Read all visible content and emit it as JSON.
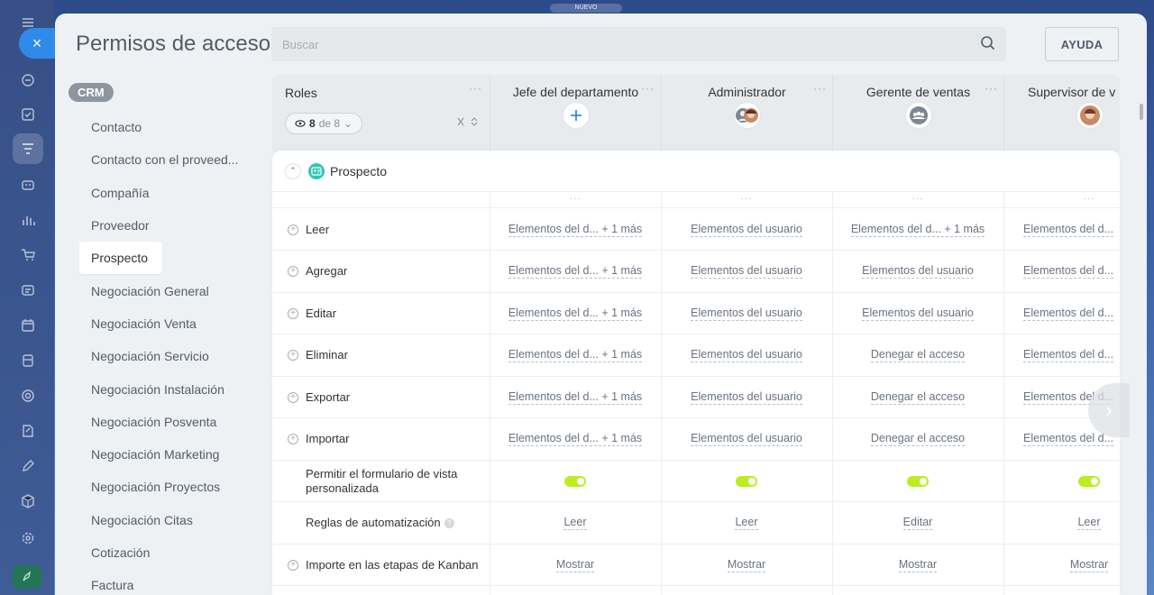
{
  "top_badge": "NUEVO",
  "close_label": "×",
  "rail_icons": [
    "menu-icon",
    "bell-icon",
    "check-square-icon",
    "filter-icon",
    "robot-icon",
    "chart-bars-icon",
    "cart-icon",
    "inbox-icon",
    "calendar-icon",
    "building-icon",
    "target-icon",
    "doc-edit-icon",
    "pen-icon",
    "box-icon",
    "gear-icon",
    "rocket-icon"
  ],
  "header": {
    "title": "Permisos de acceso",
    "search_placeholder": "Buscar",
    "help_label": "AYUDA"
  },
  "menu": {
    "badge": "CRM",
    "items": [
      {
        "label": "Contacto"
      },
      {
        "label": "Contacto con el proveed..."
      },
      {
        "label": "Compañía"
      },
      {
        "label": "Proveedor"
      },
      {
        "label": "Prospecto",
        "selected": true
      },
      {
        "label": "Negociación General"
      },
      {
        "label": "Negociación Venta"
      },
      {
        "label": "Negociación Servicio"
      },
      {
        "label": "Negociación Instalación"
      },
      {
        "label": "Negociación Posventa"
      },
      {
        "label": "Negociación Marketing"
      },
      {
        "label": "Negociación Proyectos"
      },
      {
        "label": "Negociación Citas"
      },
      {
        "label": "Cotización"
      },
      {
        "label": "Factura"
      }
    ]
  },
  "table": {
    "roles_title": "Roles",
    "roles_count_current": "8",
    "roles_count_total": "de 8",
    "columns": [
      {
        "name": "Jefe del departamento",
        "avatar": "add"
      },
      {
        "name": "Administrador",
        "avatar": "users"
      },
      {
        "name": "Gerente de ventas",
        "avatar": "group"
      },
      {
        "name": "Supervisor de v",
        "avatar": "person"
      }
    ],
    "section_title": "Prospecto",
    "rows": [
      {
        "label": "Leer",
        "expandable": true,
        "cells": [
          "Elementos del d... + 1 más",
          "Elementos del usuario",
          "Elementos del d... + 1 más",
          "Elementos del d..."
        ]
      },
      {
        "label": "Agregar",
        "expandable": true,
        "cells": [
          "Elementos del d... + 1 más",
          "Elementos del usuario",
          "Elementos del usuario",
          "Elementos del d..."
        ]
      },
      {
        "label": "Editar",
        "expandable": true,
        "cells": [
          "Elementos del d... + 1 más",
          "Elementos del usuario",
          "Elementos del usuario",
          "Elementos del d..."
        ]
      },
      {
        "label": "Eliminar",
        "expandable": true,
        "cells": [
          "Elementos del d... + 1 más",
          "Elementos del usuario",
          "Denegar el acceso",
          "Elementos del d..."
        ]
      },
      {
        "label": "Exportar",
        "expandable": true,
        "cells": [
          "Elementos del d... + 1 más",
          "Elementos del usuario",
          "Denegar el acceso",
          "Elementos del d..."
        ]
      },
      {
        "label": "Importar",
        "expandable": true,
        "cells": [
          "Elementos del d... + 1 más",
          "Elementos del usuario",
          "Denegar el acceso",
          "Elementos del d..."
        ]
      },
      {
        "label": "Permitir el formulario de vista personalizada",
        "expandable": false,
        "toggle": true,
        "toggles_on": [
          true,
          true,
          true,
          true
        ]
      },
      {
        "label": "Reglas de automatización",
        "expandable": false,
        "help": true,
        "cells": [
          "Leer",
          "Leer",
          "Editar",
          "Leer"
        ]
      },
      {
        "label": "Importe en las etapas de Kanban",
        "expandable": true,
        "cells": [
          "Mostrar",
          "Mostrar",
          "Mostrar",
          "Mostrar"
        ]
      }
    ]
  },
  "colors": {
    "accent": "#2f8bea",
    "toggle_on": "#bbed21",
    "entity_icon": "#2fc6b8"
  }
}
